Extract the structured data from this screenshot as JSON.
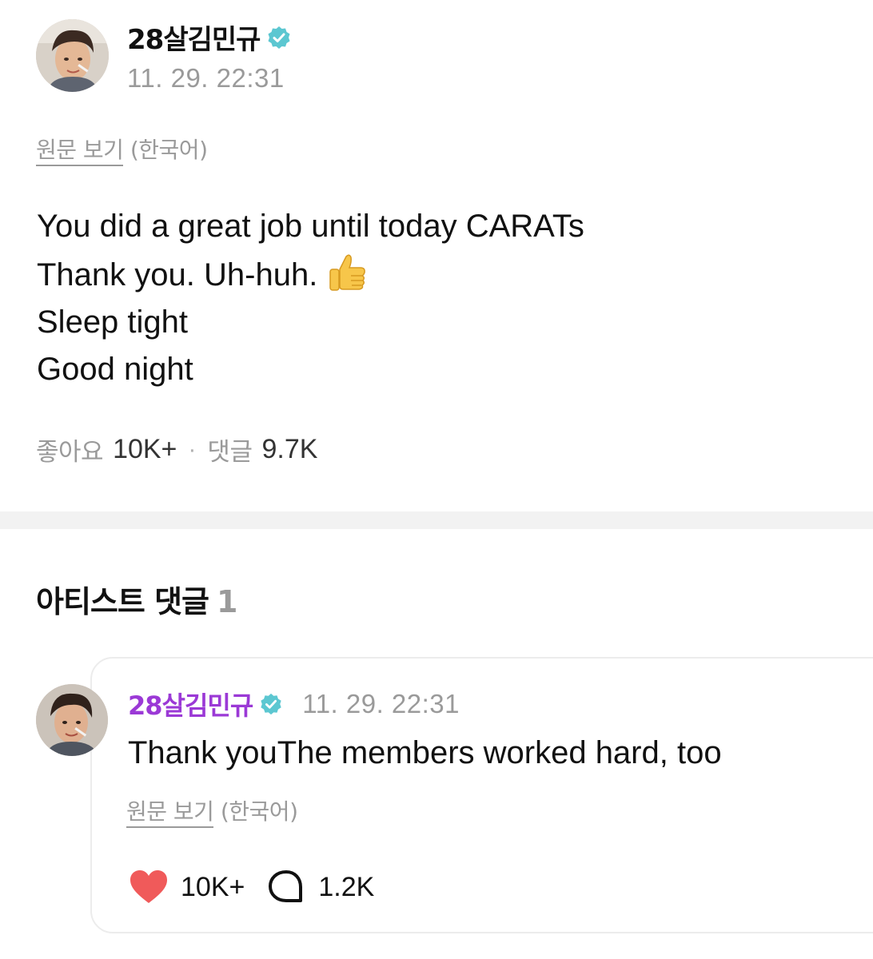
{
  "post": {
    "author": "28살김민규",
    "timestamp": "11. 29. 22:31",
    "original_link": "원문 보기",
    "original_lang": "(한국어)",
    "lines": [
      "You did a great job until today CARATs",
      "Thank you. Uh-huh.",
      "Sleep tight",
      "Good night"
    ],
    "emoji": "thumbs-up",
    "stats": {
      "likes_label": "좋아요",
      "likes_value": "10K+",
      "separator": "·",
      "comments_label": "댓글",
      "comments_value": "9.7K"
    }
  },
  "artist_comments": {
    "title": "아티스트 댓글",
    "count": "1",
    "items": [
      {
        "author": "28살김민규",
        "timestamp": "11. 29. 22:31",
        "text": "Thank youThe members worked hard, too",
        "original_link": "원문 보기",
        "original_lang": "(한국어)",
        "likes": "10K+",
        "replies": "1.2K"
      }
    ]
  },
  "colors": {
    "verified_badge": "#5cc7d1",
    "artist_name": "#9b39d6",
    "heart": "#f05a5a",
    "muted_text": "#9a9a9a",
    "divider": "#f2f2f2"
  },
  "icons": {
    "verified": "verified-badge-icon",
    "like": "heart-icon",
    "comment": "speech-bubble-icon",
    "emoji": "thumbs-up-icon"
  }
}
